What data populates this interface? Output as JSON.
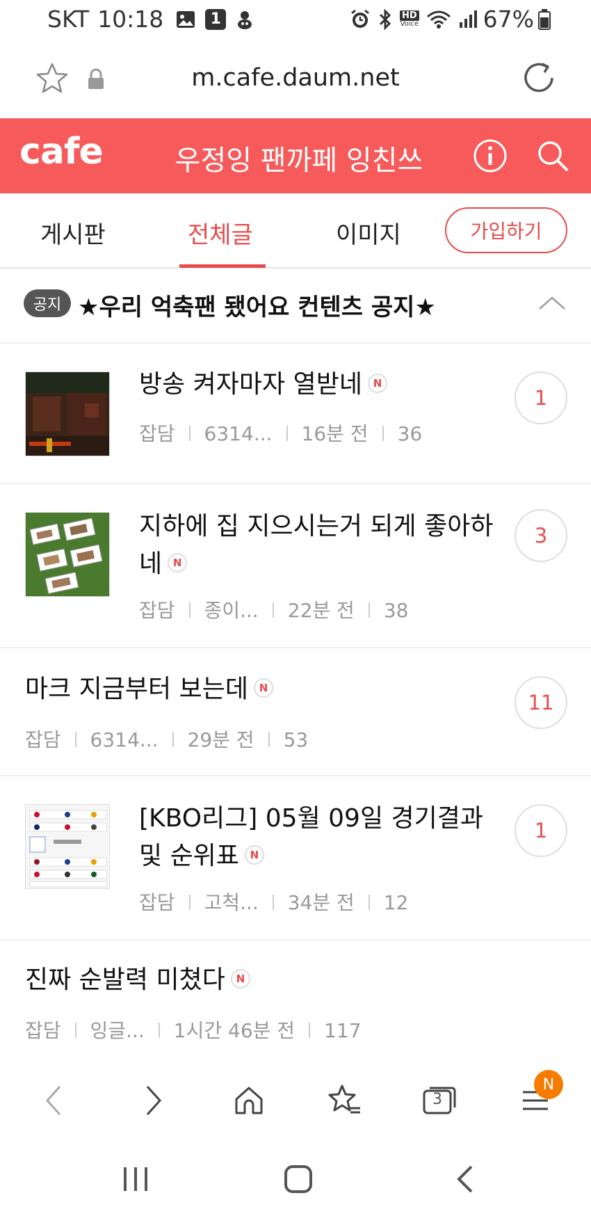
{
  "status_bar": {
    "carrier": "SKT",
    "time": "10:18",
    "notification_count": "1",
    "hd_label_top": "HD",
    "hd_label_bottom": "Voice",
    "battery": "67%"
  },
  "address_bar": {
    "url": "m.cafe.daum.net"
  },
  "cafe_header": {
    "logo": "cafe",
    "title": "우정잉 팬까페 잉친쓰"
  },
  "tabs": {
    "board": "게시판",
    "all_posts": "전체글",
    "images": "이미지",
    "join": "가입하기"
  },
  "notice": {
    "badge": "공지",
    "text": "★우리 억축팬 됐어요 컨텐츠 공지★"
  },
  "posts": [
    {
      "title": "방송 켜자마자 열받네",
      "new": "N",
      "category": "잡담",
      "author": "6314...",
      "time": "16분 전",
      "views": "36",
      "comments": "1"
    },
    {
      "title": "지하에 집 지으시는거 되게 좋아하네",
      "new": "N",
      "category": "잡담",
      "author": "종이...",
      "time": "22분 전",
      "views": "38",
      "comments": "3"
    },
    {
      "title": "마크 지금부터 보는데",
      "new": "N",
      "category": "잡담",
      "author": "6314...",
      "time": "29분 전",
      "views": "53",
      "comments": "11"
    },
    {
      "title": "[KBO리그] 05월 09일 경기결과 및 순위표",
      "new": "N",
      "category": "잡담",
      "author": "고척...",
      "time": "34분 전",
      "views": "12",
      "comments": "1"
    },
    {
      "title": "진짜 순발력 미쳤다",
      "new": "N",
      "category": "잡담",
      "author": "잉글...",
      "time": "1시간 46분 전",
      "views": "117"
    }
  ],
  "browser_toolbar": {
    "tabs_count": "3",
    "menu_badge": "N"
  },
  "colors": {
    "brand": "#f65a5a",
    "accent": "#e84b4b",
    "menu_badge": "#f57c00"
  }
}
